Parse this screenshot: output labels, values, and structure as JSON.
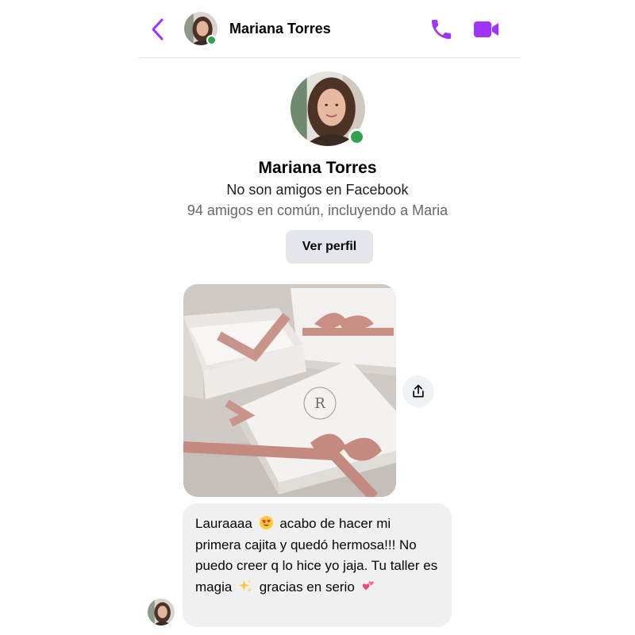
{
  "header": {
    "contact_name": "Mariana Torres",
    "back_icon": "chevron-left-icon",
    "call_icon": "phone-icon",
    "video_icon": "video-camera-icon",
    "accent_color": "#a033ff",
    "online_status": "online"
  },
  "profile": {
    "name": "Mariana Torres",
    "friend_status": "No son amigos en Facebook",
    "mutual_friends": "94 amigos en común, incluyendo a Maria",
    "view_profile_label": "Ver perfil"
  },
  "messages": [
    {
      "type": "image",
      "description_icon": "photo-gift-boxes",
      "share_icon": "share-icon"
    },
    {
      "type": "text",
      "parts": [
        "Lauraaaa",
        "acabo de hacer mi primera cajita y quedó hermosa!!! No puedo creer q lo hice yo jaja. Tu taller es magia",
        "gracias en serio"
      ],
      "emojis": [
        "heart-eyes-emoji",
        "sparkles-emoji",
        "two-hearts-emoji"
      ]
    }
  ],
  "colors": {
    "online": "#31a24c",
    "bubble": "#f0f0f0",
    "button": "#e4e6eb",
    "muted_text": "#65676b"
  }
}
